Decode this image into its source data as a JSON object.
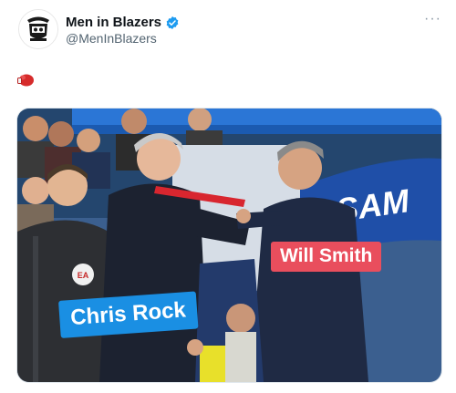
{
  "account": {
    "display_name": "Men in Blazers",
    "handle": "@MenInBlazers",
    "verified": true,
    "avatar_icon": "men-in-blazers-crest-icon"
  },
  "tweet": {
    "text_emoji": "boxing-glove-icon"
  },
  "media": {
    "labels": {
      "right": "Will Smith",
      "left": "Chris Rock"
    },
    "stand_sign_text": "SAM",
    "badge_text": "EA"
  },
  "colors": {
    "label_right_bg": "#e94e5d",
    "label_left_bg": "#1a8fe3",
    "verified": "#1d9bf0"
  }
}
